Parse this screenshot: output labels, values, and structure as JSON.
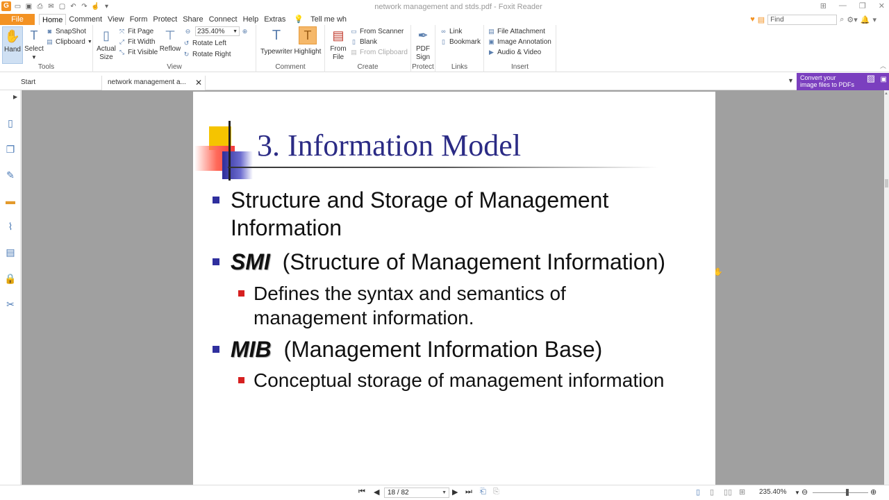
{
  "window": {
    "title": "network management and stds.pdf - Foxit Reader"
  },
  "menu": {
    "file": "File",
    "items": [
      "Home",
      "Comment",
      "View",
      "Form",
      "Protect",
      "Share",
      "Connect",
      "Help",
      "Extras"
    ],
    "tell_me": "Tell me wh",
    "find_placeholder": "Find"
  },
  "ribbon": {
    "tools": {
      "label": "Tools",
      "hand": "Hand",
      "select": "Select",
      "snapshot": "SnapShot",
      "clipboard": "Clipboard"
    },
    "view": {
      "label": "View",
      "actual_size_1": "Actual",
      "actual_size_2": "Size",
      "fit_page": "Fit Page",
      "fit_width": "Fit Width",
      "fit_visible": "Fit Visible",
      "reflow": "Reflow",
      "zoom": "235.40%",
      "rotate_left": "Rotate Left",
      "rotate_right": "Rotate Right"
    },
    "comment": {
      "label": "Comment",
      "typewriter": "Typewriter",
      "highlight": "Highlight"
    },
    "create": {
      "label": "Create",
      "from_file_1": "From",
      "from_file_2": "File",
      "from_scanner": "From Scanner",
      "blank": "Blank",
      "from_clipboard": "From Clipboard"
    },
    "protect": {
      "label": "Protect",
      "pdf_sign_1": "PDF",
      "pdf_sign_2": "Sign"
    },
    "links": {
      "label": "Links",
      "link": "Link",
      "bookmark": "Bookmark"
    },
    "insert": {
      "label": "Insert",
      "file_attachment": "File Attachment",
      "image_annotation": "Image Annotation",
      "audio_video": "Audio & Video"
    }
  },
  "tabs": {
    "start": "Start",
    "document": "network management a...",
    "promo_line1": "Convert your",
    "promo_line2": "image files to PDFs"
  },
  "slide": {
    "title": "3. Information Model",
    "bullets": [
      {
        "line1": "Structure and Storage of Management",
        "line2": "Information"
      },
      {
        "abbr": "SMI",
        "rest": "(Structure of Management Information)"
      },
      {
        "abbr": "MIB",
        "rest": "(Management Information Base)"
      }
    ],
    "subbullets": [
      {
        "line1": "Defines the syntax and semantics of",
        "line2": "management information."
      },
      {
        "line1": "Conceptual storage of management information"
      }
    ]
  },
  "status": {
    "page": "18 / 82",
    "zoom": "235.40%"
  },
  "colors": {
    "accent_orange": "#f39223",
    "promo_purple": "#7b3fbf",
    "slide_title": "#2b2b85",
    "bullet_blue": "#2f2f9e",
    "bullet_red": "#d62020",
    "workspace_gray": "#a0a0a0"
  }
}
